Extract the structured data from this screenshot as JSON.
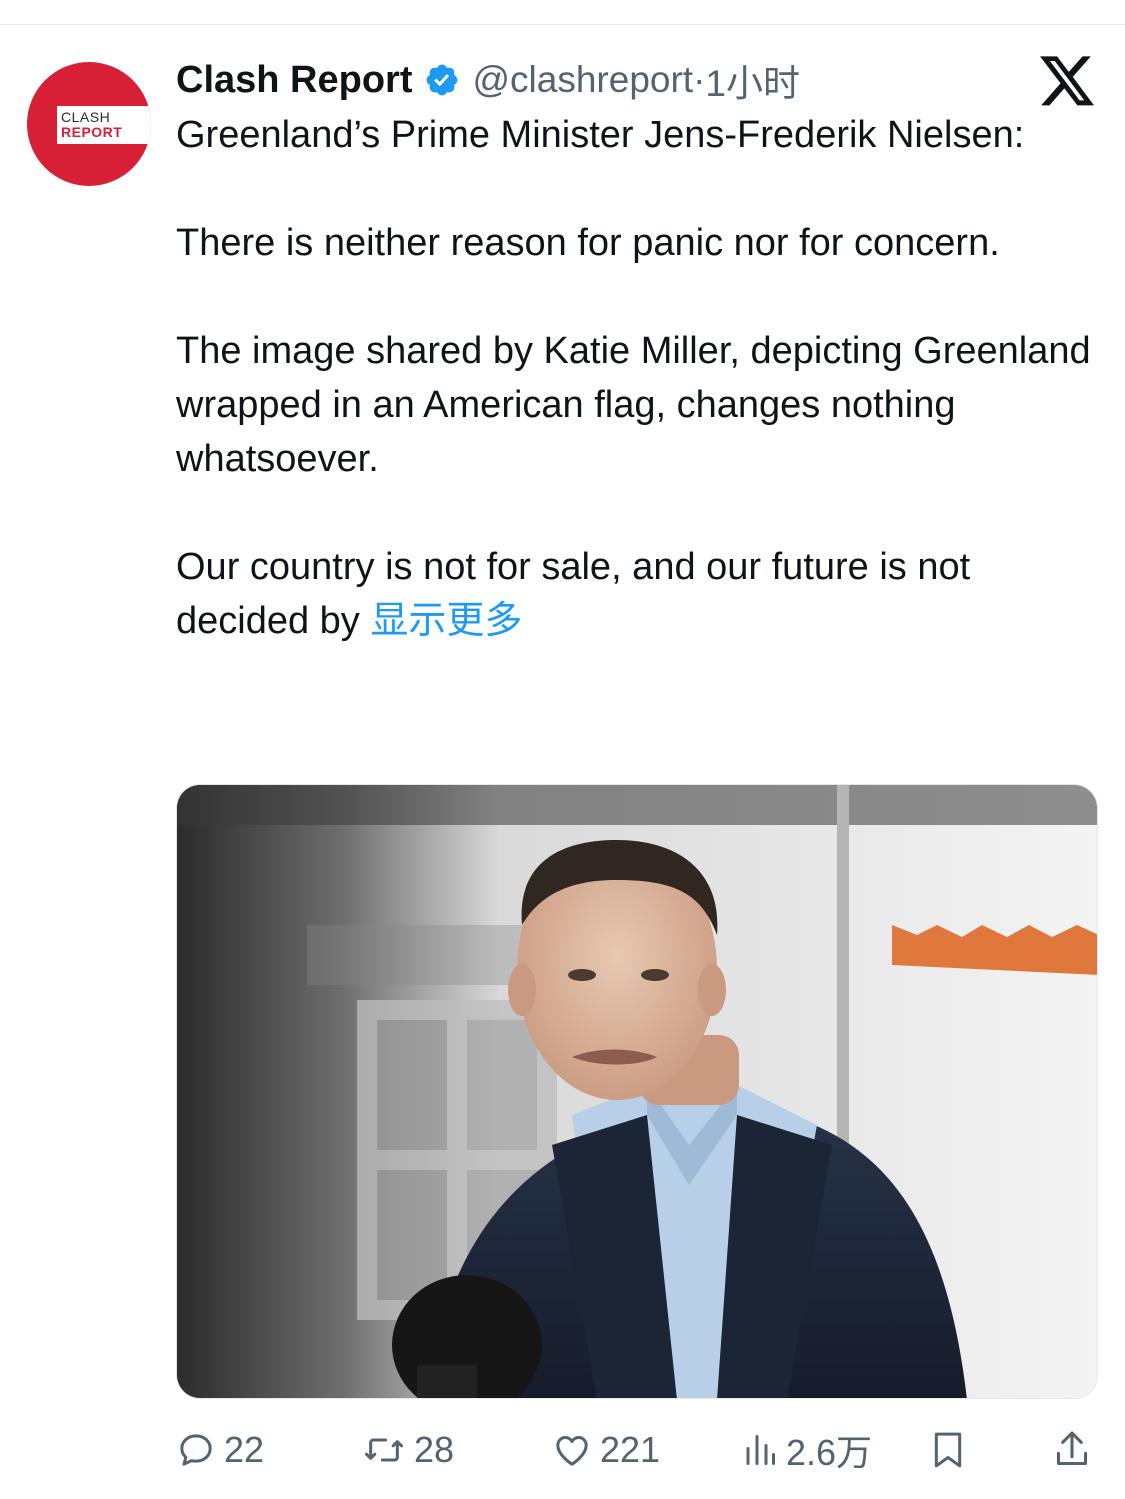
{
  "author": {
    "name": "Clash Report",
    "handle": "@clashreport",
    "separator": "·",
    "timestamp": "1小时",
    "avatar_text_line1": "CLASH",
    "avatar_text_line2": "REPORT",
    "verified_icon": "verified-badge-icon"
  },
  "platform_logo": "x-logo-icon",
  "tweet": {
    "paragraphs": [
      "Greenland’s Prime Minister Jens-Frederik Nielsen:",
      "There is neither reason for panic nor for concern.",
      "The image shared by Katie Miller, depicting Greenland wrapped in an American flag, changes nothing whatsoever."
    ],
    "last_paragraph": "Our country is not for sale, and our future is not decided by",
    "show_more": "显示更多"
  },
  "photo": {
    "icon": "photo-man-at-microphone"
  },
  "actions": {
    "replies": "22",
    "retweets": "28",
    "likes": "221",
    "views": "2.6万"
  },
  "colors": {
    "accent": "#1d9bf0",
    "muted_text": "#536471",
    "brand_red": "#d71f35"
  }
}
